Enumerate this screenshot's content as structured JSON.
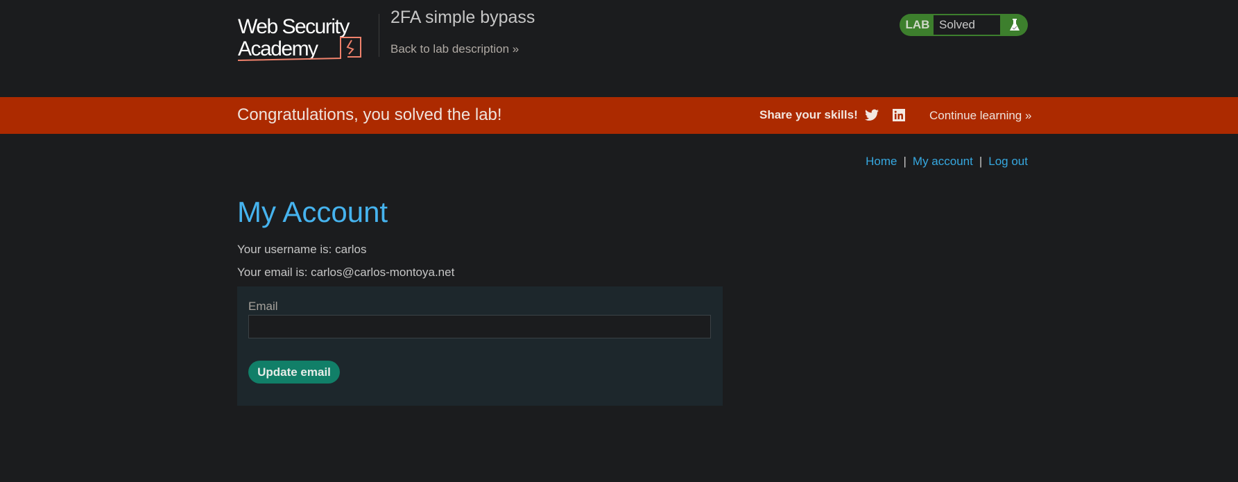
{
  "header": {
    "logo_text": "Web Security Academy",
    "lab_title": "2FA simple bypass",
    "back_link": "Back to lab description",
    "badge": {
      "label": "LAB",
      "status": "Solved",
      "color": "#3d7f2d"
    }
  },
  "banner": {
    "message": "Congratulations, you solved the lab!",
    "share_label": "Share your skills!",
    "continue_label": "Continue learning",
    "color": "#ac2a00"
  },
  "nav": {
    "home": "Home",
    "separator": "|",
    "my_account": "My account",
    "log_out": "Log out"
  },
  "main": {
    "title": "My Account",
    "username_line": "Your username is: carlos",
    "email_line": "Your email is: carlos@carlos-montoya.net",
    "form": {
      "email_label": "Email",
      "email_value": "",
      "button_label": "Update email"
    }
  }
}
